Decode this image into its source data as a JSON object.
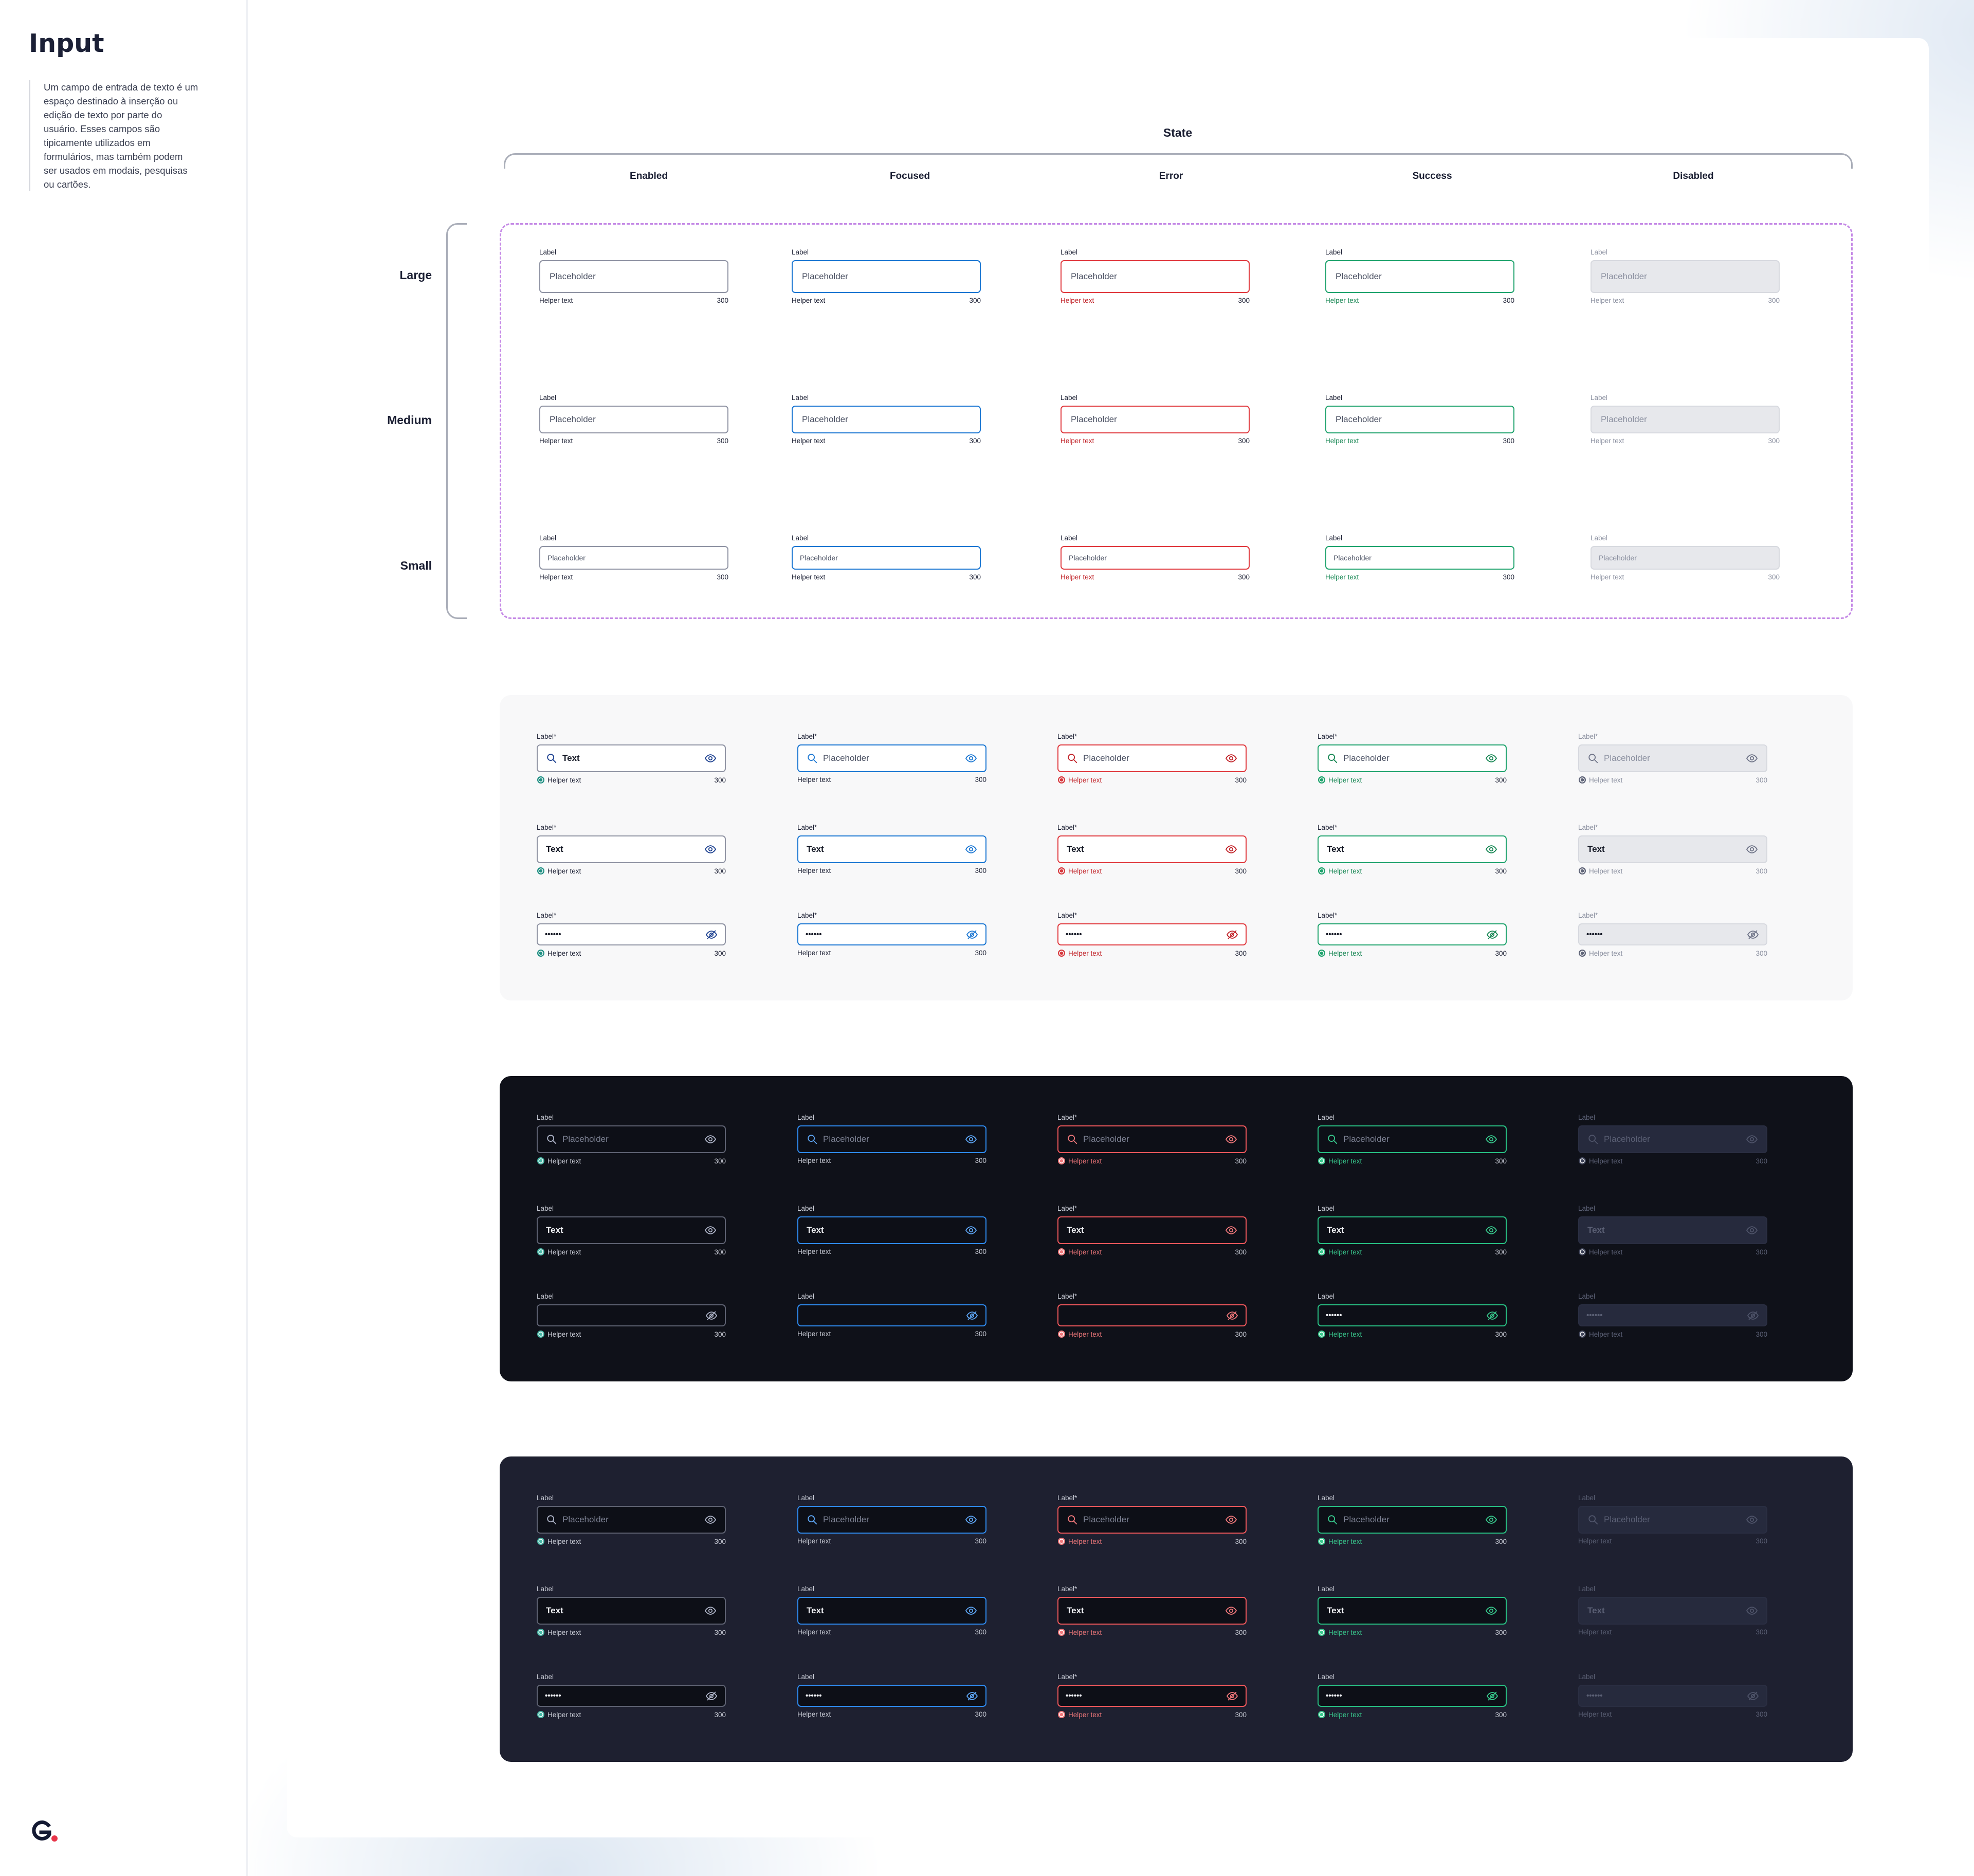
{
  "doc": {
    "title": "Input",
    "description": "Um campo de entrada de texto é um espaço destinado à inserção ou edição de texto por parte do usuário. Esses campos são tipicamente utilizados em formulários, mas também podem ser usados em modais, pesquisas ou cartões."
  },
  "logo": {
    "letter": "G",
    "dot_color": "#e8364a",
    "icon": "brand-logo-icon"
  },
  "matrix": {
    "state_title": "State",
    "states": [
      "Enabled",
      "Focused",
      "Error",
      "Success",
      "Disabled"
    ],
    "sizes": [
      "Large",
      "Medium",
      "Small"
    ]
  },
  "common": {
    "label": "Label",
    "label_required": "Label*",
    "placeholder": "Placeholder",
    "text": "Text",
    "password": "••••••",
    "helper": "Helper text",
    "count": "300"
  },
  "colors": {
    "focused": "#1a76d2",
    "error": "#e0393e",
    "success": "#1fa36d",
    "disabled_bg": "#e7e8ec",
    "dark_bg": "#0f1119",
    "darker_panel_bg": "#1e2030"
  },
  "icons": [
    "search-icon",
    "eye-icon",
    "eye-off-icon",
    "helper-status-icon"
  ]
}
